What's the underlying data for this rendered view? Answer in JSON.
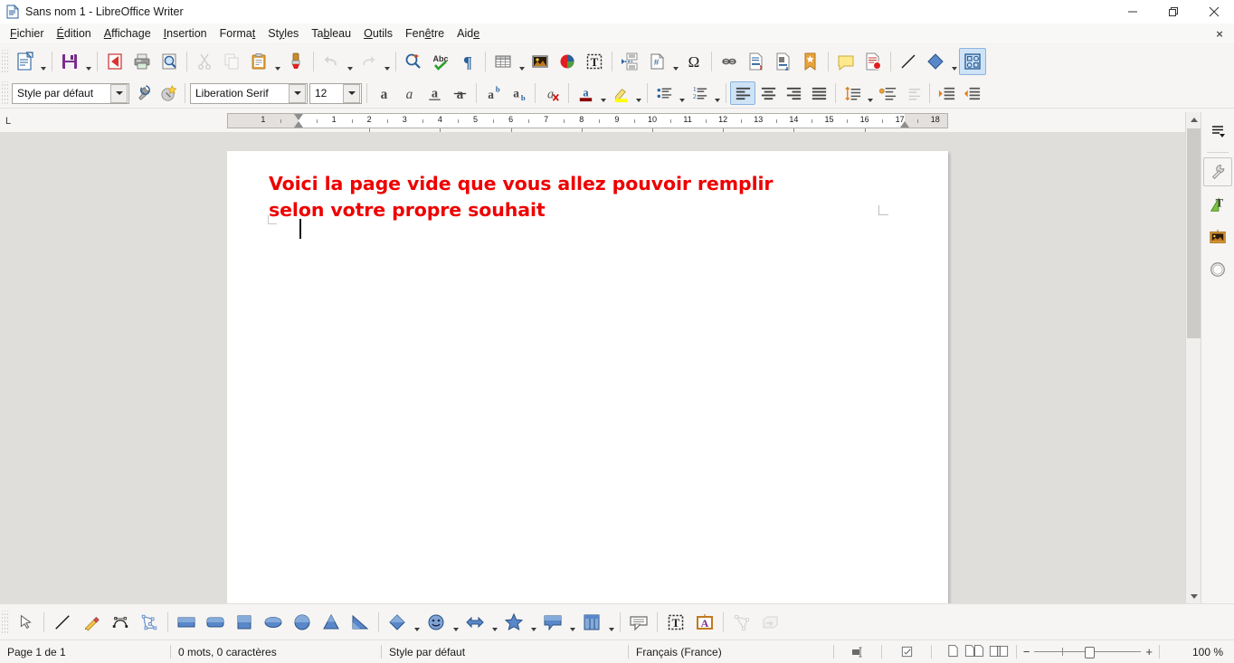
{
  "window": {
    "title": "Sans nom 1 - LibreOffice Writer",
    "app_icon": "writer-document-icon",
    "minimize_label": "Réduire",
    "restore_label": "Restaurer",
    "close_label": "Fermer",
    "close_document_label": "×"
  },
  "menubar": {
    "items": [
      {
        "label": "Fichier",
        "accel": "F"
      },
      {
        "label": "Édition",
        "accel": "É"
      },
      {
        "label": "Affichage",
        "accel": "A"
      },
      {
        "label": "Insertion",
        "accel": "I"
      },
      {
        "label": "Format",
        "accel": "t"
      },
      {
        "label": "Styles",
        "accel": "y"
      },
      {
        "label": "Tableau",
        "accel": "b"
      },
      {
        "label": "Outils",
        "accel": "O"
      },
      {
        "label": "Fenêtre",
        "accel": "ê"
      },
      {
        "label": "Aide",
        "accel": "e"
      }
    ]
  },
  "standard_toolbar": {
    "buttons": [
      {
        "name": "new-document-icon",
        "tooltip": "Nouveau"
      },
      {
        "name": "save-icon",
        "tooltip": "Enregistrer"
      },
      {
        "name": "export-pdf-icon",
        "tooltip": "Exporter directement au format PDF"
      },
      {
        "name": "print-icon",
        "tooltip": "Imprimer"
      },
      {
        "name": "print-preview-icon",
        "tooltip": "Aperçu"
      },
      {
        "name": "cut-icon",
        "tooltip": "Couper"
      },
      {
        "name": "copy-icon",
        "tooltip": "Copier"
      },
      {
        "name": "paste-icon",
        "tooltip": "Coller"
      },
      {
        "name": "clone-formatting-icon",
        "tooltip": "Cloner le formatage"
      },
      {
        "name": "undo-icon",
        "tooltip": "Annuler"
      },
      {
        "name": "redo-icon",
        "tooltip": "Rétablir"
      },
      {
        "name": "find-replace-icon",
        "tooltip": "Rechercher & remplacer"
      },
      {
        "name": "spelling-icon",
        "tooltip": "Orthographe"
      },
      {
        "name": "formatting-marks-icon",
        "tooltip": "Marques de formatage"
      },
      {
        "name": "insert-table-icon",
        "tooltip": "Insérer un tableau"
      },
      {
        "name": "insert-image-icon",
        "tooltip": "Insérer une image"
      },
      {
        "name": "insert-chart-icon",
        "tooltip": "Insérer un diagramme"
      },
      {
        "name": "insert-text-box-icon",
        "tooltip": "Insérer une zone de texte"
      },
      {
        "name": "page-break-icon",
        "tooltip": "Insérer un saut de page"
      },
      {
        "name": "insert-field-icon",
        "tooltip": "Insérer un champ"
      },
      {
        "name": "special-character-icon",
        "tooltip": "Insérer un caractère spécial"
      },
      {
        "name": "insert-hyperlink-icon",
        "tooltip": "Insérer un hyperlien"
      },
      {
        "name": "insert-footnote-icon",
        "tooltip": "Insérer une note de bas de page"
      },
      {
        "name": "insert-endnote-icon",
        "tooltip": "Insérer une note de fin"
      },
      {
        "name": "insert-bookmark-icon",
        "tooltip": "Insérer un repère de texte"
      },
      {
        "name": "insert-comment-icon",
        "tooltip": "Insérer un commentaire"
      },
      {
        "name": "track-changes-icon",
        "tooltip": "Enregistrer les modifications"
      },
      {
        "name": "insert-line-icon",
        "tooltip": "Insérer une ligne"
      },
      {
        "name": "basic-shapes-icon",
        "tooltip": "Formes de base"
      },
      {
        "name": "show-draw-functions-icon",
        "tooltip": "Afficher les fonctions de dessin"
      }
    ],
    "special_character_glyph": "Ω"
  },
  "formatting_toolbar": {
    "paragraph_style": "Style par défaut",
    "font_name": "Liberation Serif",
    "font_size": "12",
    "buttons": [
      {
        "name": "update-style-icon",
        "tooltip": "Actualiser le style"
      },
      {
        "name": "new-style-icon",
        "tooltip": "Nouveau style"
      },
      {
        "name": "bold-icon",
        "tooltip": "Gras",
        "glyph": "a"
      },
      {
        "name": "italic-icon",
        "tooltip": "Italique",
        "glyph": "a"
      },
      {
        "name": "underline-icon",
        "tooltip": "Souligné",
        "glyph": "a"
      },
      {
        "name": "strikethrough-icon",
        "tooltip": "Barré",
        "glyph": "a"
      },
      {
        "name": "superscript-icon",
        "tooltip": "Exposant"
      },
      {
        "name": "subscript-icon",
        "tooltip": "Indice"
      },
      {
        "name": "clear-formatting-icon",
        "tooltip": "Effacer le formatage direct"
      },
      {
        "name": "font-color-icon",
        "tooltip": "Couleur de police"
      },
      {
        "name": "highlighting-color-icon",
        "tooltip": "Couleur de surlignage"
      },
      {
        "name": "unordered-list-icon",
        "tooltip": "Liste à puces"
      },
      {
        "name": "ordered-list-icon",
        "tooltip": "Liste numérotée"
      },
      {
        "name": "align-left-icon",
        "tooltip": "Aligner à gauche"
      },
      {
        "name": "align-center-icon",
        "tooltip": "Centrer"
      },
      {
        "name": "align-right-icon",
        "tooltip": "Aligner à droite"
      },
      {
        "name": "justify-icon",
        "tooltip": "Justifié"
      },
      {
        "name": "line-spacing-icon",
        "tooltip": "Interligne"
      },
      {
        "name": "increase-paragraph-spacing-icon",
        "tooltip": "Augmenter l'espacement"
      },
      {
        "name": "decrease-paragraph-spacing-icon",
        "tooltip": "Réduire l'espacement"
      },
      {
        "name": "increase-indent-icon",
        "tooltip": "Augmenter le retrait"
      },
      {
        "name": "decrease-indent-icon",
        "tooltip": "Réduire le retrait"
      }
    ],
    "font_color_swatch": "#8b0000",
    "highlight_color_swatch": "#ffff00",
    "active_alignment": "align-left-icon"
  },
  "ruler": {
    "tab_stop_indicator": "L",
    "numbers": [
      "1",
      "2",
      "3",
      "4",
      "5",
      "6",
      "7",
      "8",
      "9",
      "10",
      "11",
      "12",
      "13",
      "14",
      "15",
      "16",
      "17",
      "18"
    ],
    "unit": "cm"
  },
  "document": {
    "text": "Voici la page vide que vous allez pouvoir remplir selon votre propre souhait",
    "text_color": "#ee0000",
    "page_background": "#ffffff",
    "workspace_background": "#e0dedb"
  },
  "sidebar": {
    "items": [
      {
        "name": "sidebar-settings-icon",
        "label": "Paramètres de la barre latérale"
      },
      {
        "name": "sidebar-properties-icon",
        "label": "Propriétés"
      },
      {
        "name": "sidebar-styles-icon",
        "label": "Styles"
      },
      {
        "name": "sidebar-gallery-icon",
        "label": "Galerie"
      },
      {
        "name": "sidebar-navigator-icon",
        "label": "Navigateur"
      }
    ]
  },
  "drawing_toolbar": {
    "buttons": [
      {
        "name": "select-tool-icon",
        "tooltip": "Sélectionner"
      },
      {
        "name": "insert-line-icon",
        "tooltip": "Insérer une ligne"
      },
      {
        "name": "freeform-line-icon",
        "tooltip": "Ligne à main levée"
      },
      {
        "name": "curve-icon",
        "tooltip": "Courbe"
      },
      {
        "name": "polygon-icon",
        "tooltip": "Polygone"
      },
      {
        "name": "rectangle-icon",
        "tooltip": "Rectangle"
      },
      {
        "name": "rounded-rectangle-icon",
        "tooltip": "Rectangle arrondi"
      },
      {
        "name": "square-icon",
        "tooltip": "Carré"
      },
      {
        "name": "ellipse-icon",
        "tooltip": "Ellipse"
      },
      {
        "name": "circle-icon",
        "tooltip": "Cercle"
      },
      {
        "name": "triangle-icon",
        "tooltip": "Triangle isocèle"
      },
      {
        "name": "right-triangle-icon",
        "tooltip": "Triangle rectangle"
      },
      {
        "name": "basic-shapes-icon",
        "tooltip": "Formes de base"
      },
      {
        "name": "symbol-shapes-icon",
        "tooltip": "Formes de symbole"
      },
      {
        "name": "block-arrows-icon",
        "tooltip": "Flèches pleines"
      },
      {
        "name": "stars-icon",
        "tooltip": "Étoiles et bannières"
      },
      {
        "name": "callouts-icon",
        "tooltip": "Légendes"
      },
      {
        "name": "flowchart-icon",
        "tooltip": "Organigramme"
      },
      {
        "name": "insert-callout-icon",
        "tooltip": "Insérer une légende"
      },
      {
        "name": "insert-text-box-icon",
        "tooltip": "Insérer une zone de texte"
      },
      {
        "name": "fontwork-icon",
        "tooltip": "Fontwork"
      },
      {
        "name": "edit-points-icon",
        "tooltip": "Éditer les points"
      },
      {
        "name": "extrusion-icon",
        "tooltip": "Activer/désactiver l'extrusion"
      }
    ]
  },
  "statusbar": {
    "page": "Page 1 de 1",
    "word_count": "0 mots, 0 caractères",
    "page_style": "Style par défaut",
    "language": "Français (France)",
    "selection_mode_icon": "selection-mode-icon",
    "save_status_icon": "document-modified-icon",
    "view_layouts": [
      {
        "name": "single-page-view-icon",
        "label": "Affichage d'une seule page"
      },
      {
        "name": "multi-page-view-icon",
        "label": "Affichage multipage"
      },
      {
        "name": "book-view-icon",
        "label": "Affichage livre"
      }
    ],
    "zoom_out_label": "−",
    "zoom_in_label": "+",
    "zoom_level": "100 %"
  }
}
